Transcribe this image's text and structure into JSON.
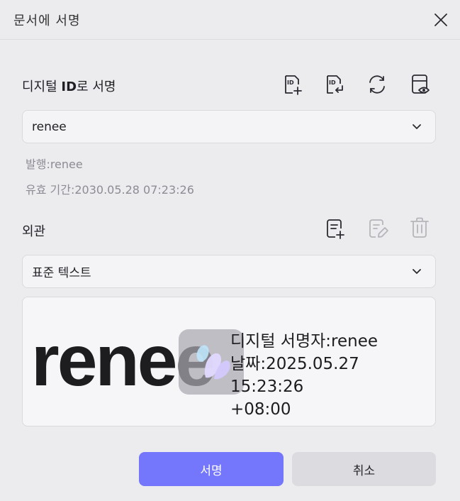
{
  "dialog": {
    "title": "문서에 서명"
  },
  "digital_id": {
    "label_prefix": "디지털 ",
    "label_bold": "ID",
    "label_suffix": "로 서명",
    "selected": "renee",
    "issuer": "발행:renee",
    "validity": "유효 기간:2030.05.28 07:23:26"
  },
  "appearance": {
    "label": "외관",
    "selected": "표준 텍스트",
    "preview": {
      "name": "renee",
      "line1": "디지털 서명자:renee",
      "line2": "날짜:2025.05.27 15:23:26",
      "line3": "+08:00"
    }
  },
  "buttons": {
    "sign": "서명",
    "cancel": "취소"
  },
  "colors": {
    "accent": "#7476fb",
    "icon": "#2a2a30",
    "icon_disabled": "#b4b4ba"
  }
}
